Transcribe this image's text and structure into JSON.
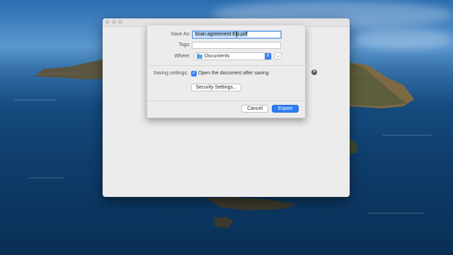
{
  "save_dialog": {
    "save_as": {
      "label": "Save As:",
      "value": "Scan agreement EN.pdf"
    },
    "tags": {
      "label": "Tags:",
      "value": ""
    },
    "where": {
      "label": "Where:",
      "value": "Documents",
      "icon": "folder-icon"
    },
    "saving_settings": {
      "label": "Saving settings:",
      "open_after_saving": {
        "label": "Open the document after saving",
        "checked": true
      }
    },
    "security_settings_label": "Security Settings...",
    "cancel_label": "Cancel",
    "export_label": "Export"
  },
  "colors": {
    "accent": "#2f7cf6",
    "selection": "#b4d3f7"
  }
}
